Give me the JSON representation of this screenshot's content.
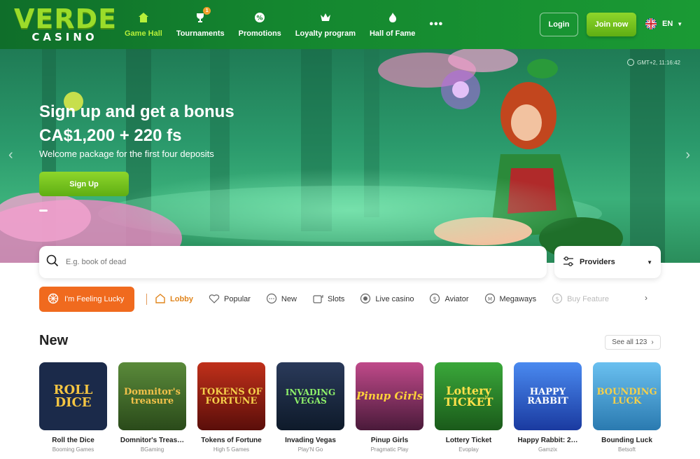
{
  "header": {
    "logo_top": "VERDE",
    "logo_bottom": "CASINO",
    "nav": [
      {
        "label": "Game Hall",
        "icon": "home-icon",
        "active": true
      },
      {
        "label": "Tournaments",
        "icon": "trophy-icon",
        "badge": "1"
      },
      {
        "label": "Promotions",
        "icon": "percent-icon"
      },
      {
        "label": "Loyalty program",
        "icon": "crown-icon"
      },
      {
        "label": "Hall of Fame",
        "icon": "flame-icon"
      }
    ],
    "more": "•••",
    "login": "Login",
    "join": "Join now",
    "lang": "EN"
  },
  "hero": {
    "time": "GMT+2, 11:16:42",
    "title": "Sign up and get a bonus",
    "amount": "CA$1,200 + 220 fs",
    "subtitle": "Welcome package for the first four deposits",
    "cta": "Sign Up"
  },
  "search": {
    "placeholder": "E.g. book of dead"
  },
  "providers": {
    "label": "Providers"
  },
  "lucky": {
    "label": "I'm Feeling Lucky"
  },
  "tabs": [
    {
      "label": "Lobby",
      "icon": "lobby-icon",
      "active": true
    },
    {
      "label": "Popular",
      "icon": "heart-icon"
    },
    {
      "label": "New",
      "icon": "new-icon"
    },
    {
      "label": "Slots",
      "icon": "slots-icon"
    },
    {
      "label": "Live casino",
      "icon": "live-icon"
    },
    {
      "label": "Aviator",
      "icon": "aviator-icon"
    },
    {
      "label": "Megaways",
      "icon": "megaways-icon"
    },
    {
      "label": "Buy Feature",
      "icon": "buy-icon",
      "faded": true
    }
  ],
  "section": {
    "title": "New",
    "see_all": "See all 123"
  },
  "games": [
    {
      "name": "Roll the Dice",
      "provider": "Booming Games",
      "art": "ROLL DICE",
      "bg": "#1b2a4a",
      "fg": "#f5c542"
    },
    {
      "name": "Domnitor's Treas…",
      "provider": "BGaming",
      "art": "Domnitor's treasure",
      "bg": "#3a5a2a",
      "fg": "#f2c14a"
    },
    {
      "name": "Tokens of Fortune",
      "provider": "High 5 Games",
      "art": "TOKENS OF FORTUNE",
      "bg": "#7a1a14",
      "fg": "#f5d04a"
    },
    {
      "name": "Invading Vegas",
      "provider": "Play'N Go",
      "art": "INVADING VEGAS",
      "bg": "#1a2a3a",
      "fg": "#8ef06a"
    },
    {
      "name": "Pinup Girls",
      "provider": "Pragmatic Play",
      "art": "Pinup Girls",
      "bg": "#7a2a5a",
      "fg": "#ffd23a"
    },
    {
      "name": "Lottery Ticket",
      "provider": "Evoplay",
      "art": "Lottery TICKET",
      "bg": "#2a7a2a",
      "fg": "#ffe14a"
    },
    {
      "name": "Happy Rabbit: 2…",
      "provider": "Gamzix",
      "art": "HAPPY RABBIT",
      "bg": "#2a5ad0",
      "fg": "#ffffff"
    },
    {
      "name": "Bounding Luck",
      "provider": "Betsoft",
      "art": "BOUNDING LUCK",
      "bg": "#3a9ad0",
      "fg": "#f5d04a"
    }
  ]
}
